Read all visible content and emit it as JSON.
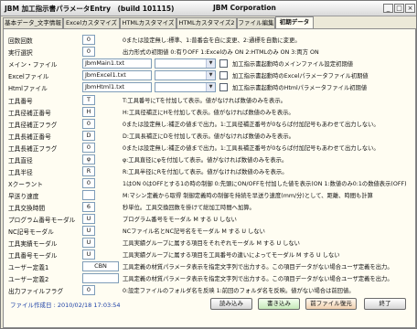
{
  "window": {
    "title": "JBM 加工指示書パラメータEntry　(build 101115)",
    "company": "JBM Corporation",
    "controls": {
      "minimize": "_",
      "maximize": "□",
      "close": "×"
    }
  },
  "tabs": [
    {
      "label": "基本データ_文字情報"
    },
    {
      "label": "Excelカスタマイズ"
    },
    {
      "label": "HTMLカスタマイズ"
    },
    {
      "label": "HTMLカスタマイズ2"
    },
    {
      "label": "ファイル編集"
    },
    {
      "label": "初期データ"
    }
  ],
  "rows": [
    {
      "label": "回数回数",
      "value": "0",
      "desc": "0または設定無し:標準、1:普番会を自に変更、2:通標を自動に変更。"
    },
    {
      "label": "実行選択",
      "value": "0",
      "desc": "出力形式の初期値 0:有りOFF 1:Excelのみ ON 2:HTMLのみ ON 3:両方 ON"
    },
    {
      "label": "メイン・ファイル",
      "value": "JbmMain1.txt",
      "desc": "加工指示書起動時のメインファイル設定初期値"
    },
    {
      "label": "Excelファイル",
      "value": "JbmExcel1.txt",
      "desc": "加工指示書起動時のExcelパラメータファイル初期値"
    },
    {
      "label": "Htmlファイル",
      "value": "JbmHtml1.txt",
      "desc": "加工指示書起動時のHtmlパラメータファイル初期値"
    },
    {
      "label": "工具番号",
      "value": "T",
      "desc": "T:工具番号にTを付加して表示。値がなければ数値のみを表示。"
    },
    {
      "label": "工具径補正番号",
      "value": "H",
      "desc": "H:工具径補正にHを付加して表示。値がなければ数値のみを表示。"
    },
    {
      "label": "工具径補正フラグ",
      "value": "0",
      "desc": "0または設定無し:補正の値まで出力。1:工具径補正番号が0ならば付加記号もあわせて出力しない。"
    },
    {
      "label": "工具長補正番号",
      "value": "D",
      "desc": "D:工具長補正にDを付加して表示。値がなければ数値のみを表示。"
    },
    {
      "label": "工具長補正フラグ",
      "value": "0",
      "desc": "0または設定無し:補正の値まで出力。1:工具長補正番号が0ならば付加記号もあわせて出力しない。"
    },
    {
      "label": "工具直径",
      "value": "φ",
      "desc": "φ:工具直径にφを付加して表示。値がなければ数値のみを表示。"
    },
    {
      "label": "工具半径",
      "value": "R",
      "desc": "R:工具半径にRを付加して表示。値がなければ数値のみを表示。"
    },
    {
      "label": "Xクーラント",
      "value": "0",
      "desc": "1はON 0はOFFとする1の時の制御 0:先頭にON/OFFを付加した値を表示(ON 1:数値のみ0:1の数値表示(OFF)"
    },
    {
      "label": "早送り速度",
      "value": "",
      "desc": "M:マシン定義から取得  制御定義時の制御を持続を早送り速度(mm/分)として、距離、時間も計算"
    },
    {
      "label": "工具交換時間",
      "value": "6",
      "desc": "秒単位。工具交換回数を掛けて総加工時間へ加算。"
    },
    {
      "label": "プログラム番号モーダル",
      "value": "U",
      "desc": "プログラム番号をモーダル M する U しない"
    },
    {
      "label": "NC記号モーダル",
      "value": "U",
      "desc": "NCファイル名とNC記号名をモーダル M する U しない"
    },
    {
      "label": "工具実績モーダル",
      "value": "U",
      "desc": "工具実績グループに属する項目をそれぞれモーダル M する U しない"
    },
    {
      "label": "工具番号モーダル",
      "value": "U",
      "desc": "工具実績グループに属する項目を工具番号の違いによってモーダル M する U しない"
    },
    {
      "label": "ユーザー定義1",
      "value": "CBN",
      "desc": "工具定義の材質パラメータ表示を指定文字列で出力する。この項目データがない場合ユーザ定義を出力。"
    },
    {
      "label": "ユーザー定義2",
      "value": "",
      "desc": "工具定義の材質パラメータ表示を指定文字列で出力する。この項目データがない場合ユーザ定義を出力。"
    },
    {
      "label": "出力ファイルフラグ",
      "value": "0",
      "desc": "0:設定ファイルのフォルダ名を反映 1:前回のフォルダ名を反映。値がない場合は前回値。"
    }
  ],
  "combos": [
    {
      "value": ""
    },
    {
      "value": ""
    },
    {
      "value": ""
    }
  ],
  "status": {
    "file_created": "ファイル作成日 : 2010/02/18 17:03:54"
  },
  "buttons": {
    "load": "読み込み",
    "save": "書き込み",
    "restore": "前ファイル復元",
    "exit": "終了"
  }
}
